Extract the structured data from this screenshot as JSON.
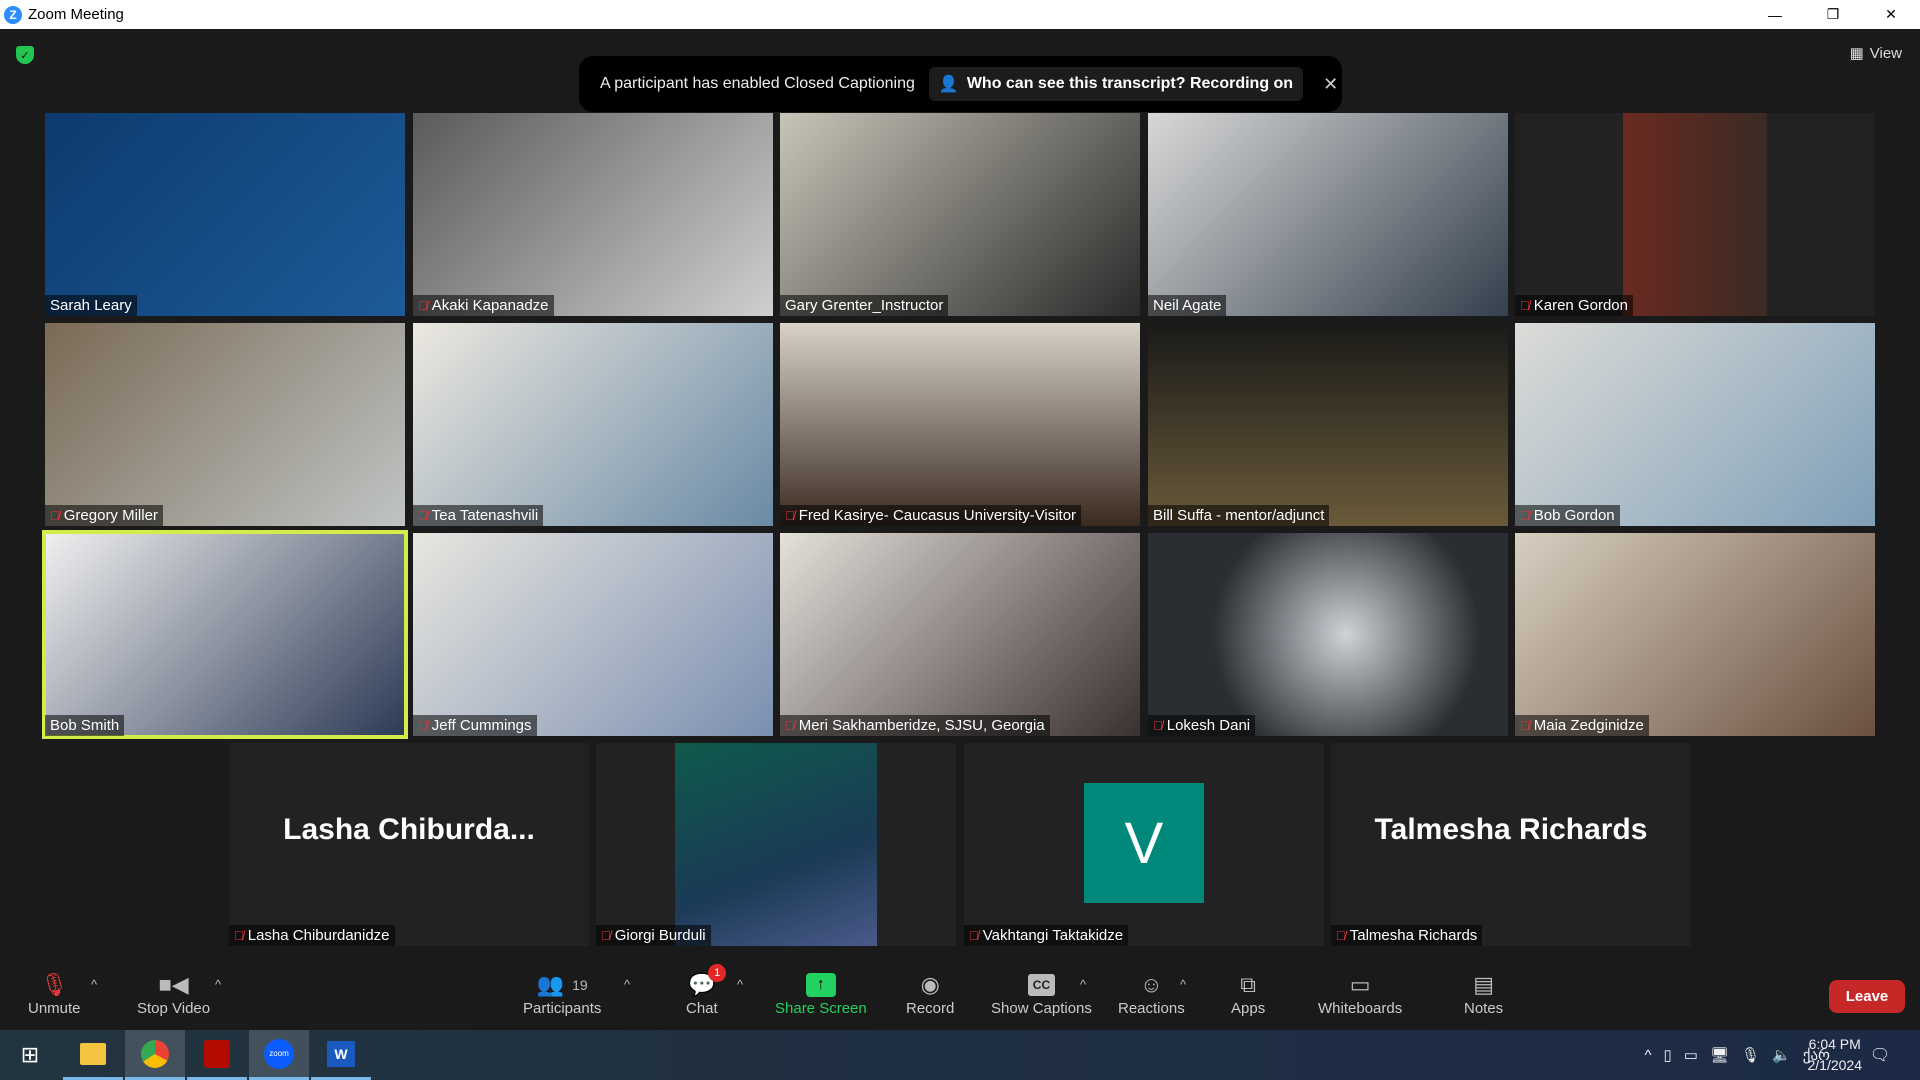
{
  "window": {
    "title": "Zoom Meeting",
    "minimize": "—",
    "restore": "❐",
    "close": "✕"
  },
  "header": {
    "view_label": "View",
    "banner": {
      "message": "A participant has enabled Closed Captioning",
      "transcript_button": "Who can see this transcript? Recording on",
      "close": "✕"
    }
  },
  "participants": [
    {
      "name": "Sarah Leary",
      "muted": false,
      "bg": "linear-gradient(135deg,#0d3a6e,#1d5b99)"
    },
    {
      "name": "Akaki Kapanadze",
      "muted": true,
      "bg": "linear-gradient(135deg,#5a5a5a,#cfcfcf)"
    },
    {
      "name": "Gary Grenter_Instructor",
      "muted": false,
      "bg": "linear-gradient(135deg,#c8c4b8,#2a2a2a)"
    },
    {
      "name": "Neil Agate",
      "muted": false,
      "bg": "linear-gradient(135deg,#d8d8d8,#34404d)"
    },
    {
      "name": "Karen Gordon",
      "muted": true,
      "bg": "linear-gradient(90deg,#222 30%,#6a2a20 30%,#3a2a25 70%,#222 70%)"
    },
    {
      "name": "Gregory Miller",
      "muted": true,
      "bg": "linear-gradient(135deg,#7a6a55,#bfc4c4)"
    },
    {
      "name": "Tea Tatenashvili",
      "muted": true,
      "bg": "linear-gradient(135deg,#ece8e0,#6a8aa5)"
    },
    {
      "name": "Fred Kasirye- Caucasus University-Visitor",
      "muted": true,
      "bg": "linear-gradient(180deg,#d8d2c8,#3a2a20)"
    },
    {
      "name": "Bill Suffa - mentor/adjunct",
      "muted": false,
      "bg": "linear-gradient(180deg,#1a1a18,#6a5a3a)"
    },
    {
      "name": "Bob Gordon",
      "muted": true,
      "bg": "linear-gradient(135deg,#dcdcd8,#7f9fb8)"
    },
    {
      "name": "Bob Smith",
      "muted": false,
      "active": true,
      "bg": "linear-gradient(135deg,#f0f0f0,#2c3a55)"
    },
    {
      "name": "Jeff Cummings",
      "muted": true,
      "bg": "linear-gradient(135deg,#e8e6e0,#7a8fb0)"
    },
    {
      "name": "Meri Sakhamberidze, SJSU, Georgia",
      "muted": true,
      "bg": "linear-gradient(135deg,#e4e0da,#3a3030)"
    },
    {
      "name": "Lokesh Dani",
      "muted": true,
      "bg": "radial-gradient(circle at 55% 50%,#cfd3d8,#2a2d32 60%)"
    },
    {
      "name": "Maia Zedginidze",
      "muted": true,
      "bg": "linear-gradient(135deg,#d8cfc0,#6a5040)"
    }
  ],
  "bottom_row": [
    {
      "name": "Lasha Chiburdanidze",
      "display": "Lasha  Chiburda...",
      "type": "name",
      "muted": true
    },
    {
      "name": "Giorgi Burduli",
      "type": "video",
      "muted": true
    },
    {
      "name": "Vakhtangi Taktakidze",
      "type": "avatar",
      "initial": "V",
      "muted": true
    },
    {
      "name": "Talmesha Richards",
      "display": "Talmesha Richards",
      "type": "name",
      "muted": true
    }
  ],
  "toolbar": {
    "unmute": "Unmute",
    "stop_video": "Stop Video",
    "participants": "Participants",
    "participant_count": "19",
    "chat": "Chat",
    "chat_badge": "1",
    "share_screen": "Share Screen",
    "record": "Record",
    "show_captions": "Show Captions",
    "cc": "CC",
    "reactions": "Reactions",
    "apps": "Apps",
    "whiteboards": "Whiteboards",
    "notes": "Notes",
    "leave": "Leave"
  },
  "taskbar": {
    "zoom_label": "zoom",
    "word_label": "W",
    "language": "ქარ",
    "time": "6:04 PM",
    "date": "2/1/2024"
  },
  "colors": {
    "active_speaker": "#d4ec4a",
    "share_green": "#23d160",
    "leave_red": "#c62828",
    "avatar_teal": "#00897b"
  }
}
